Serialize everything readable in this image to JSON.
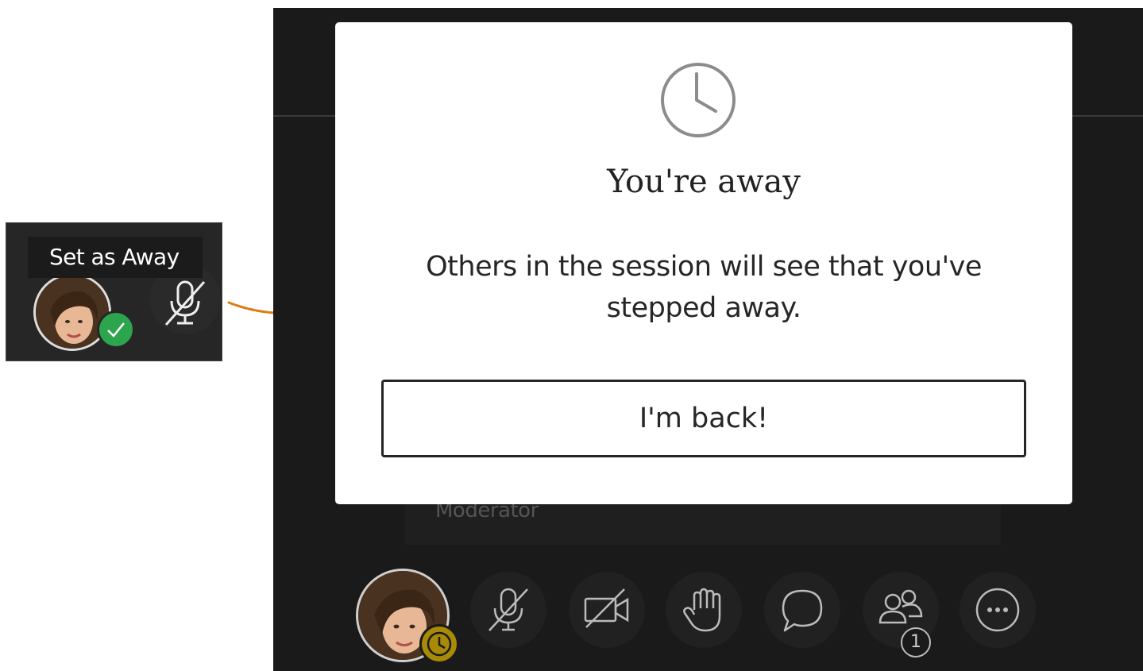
{
  "callout": {
    "tooltip": "Set as Away",
    "status_icon": "check-icon",
    "mic_icon": "mic-muted-icon",
    "status_color": "#2da44e"
  },
  "session": {
    "role_label": "Moderator",
    "toolbar": {
      "items": [
        "avatar",
        "mic-muted-icon",
        "camera-off-icon",
        "raise-hand-icon",
        "chat-icon",
        "participants-icon",
        "more-icon"
      ],
      "participants_count": "1",
      "away_status_color": "#a88a06"
    }
  },
  "modal": {
    "icon": "clock-icon",
    "title": "You're away",
    "message": "Others in the session will see that you've stepped away.",
    "button_label": "I'm back!"
  },
  "colors": {
    "annotation_arrow": "#e07b10",
    "panel_background": "#1a1a1a"
  }
}
